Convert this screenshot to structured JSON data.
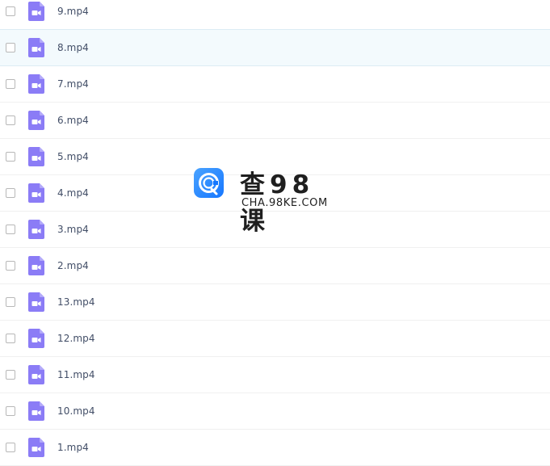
{
  "files": [
    {
      "name": "9.mp4",
      "icon": "video-file-icon"
    },
    {
      "name": "8.mp4",
      "icon": "video-file-icon",
      "hovered": true
    },
    {
      "name": "7.mp4",
      "icon": "video-file-icon"
    },
    {
      "name": "6.mp4",
      "icon": "video-file-icon"
    },
    {
      "name": "5.mp4",
      "icon": "video-file-icon"
    },
    {
      "name": "4.mp4",
      "icon": "video-file-icon"
    },
    {
      "name": "3.mp4",
      "icon": "video-file-icon"
    },
    {
      "name": "2.mp4",
      "icon": "video-file-icon"
    },
    {
      "name": "13.mp4",
      "icon": "video-file-icon"
    },
    {
      "name": "12.mp4",
      "icon": "video-file-icon"
    },
    {
      "name": "11.mp4",
      "icon": "video-file-icon"
    },
    {
      "name": "10.mp4",
      "icon": "video-file-icon"
    },
    {
      "name": "1.mp4",
      "icon": "video-file-icon"
    }
  ],
  "watermark": {
    "title": "查98课",
    "subtitle": "CHA.98KE.COM"
  },
  "colors": {
    "icon_purple": "#8b7cf6",
    "text": "#424e67",
    "hover_bg": "#f3fafd",
    "watermark_blue": "#1677ff"
  }
}
